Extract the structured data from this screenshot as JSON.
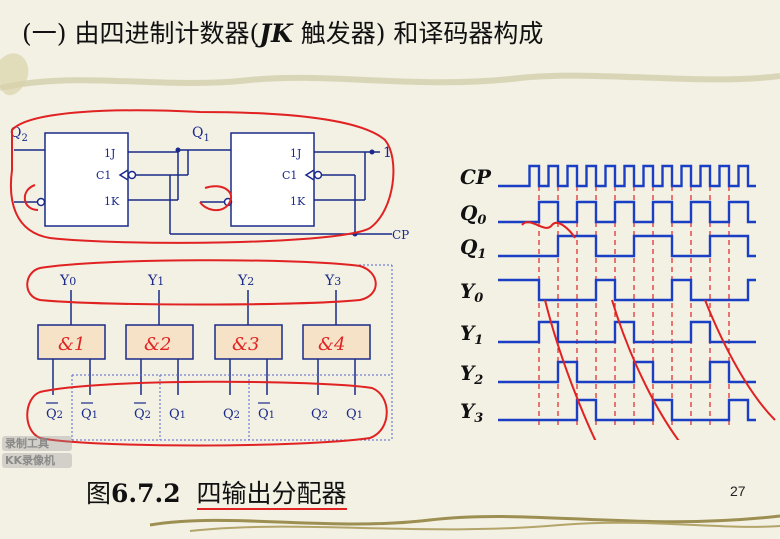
{
  "title": {
    "prefix": "(一) 由四进制计数器(",
    "jk": "JK",
    "suffix": " 触发器) 和译码器构成"
  },
  "circuit": {
    "ff1": {
      "pin_j": "1J",
      "pin_c": "C1",
      "pin_k": "1K"
    },
    "ff2": {
      "pin_j": "1J",
      "pin_c": "C1",
      "pin_k": "1K"
    },
    "q2_label": "Q",
    "q2_sub": "2",
    "q1_label": "Q",
    "q1_sub": "1",
    "one_label": "1",
    "cp_label": "CP",
    "outputs": [
      {
        "label": "Y",
        "sub": "0"
      },
      {
        "label": "Y",
        "sub": "1"
      },
      {
        "label": "Y",
        "sub": "2"
      },
      {
        "label": "Y",
        "sub": "3"
      }
    ],
    "gate_inputs": [
      [
        {
          "label": "Q",
          "sub": "2",
          "bar": true
        },
        {
          "label": "Q",
          "sub": "1",
          "bar": true
        }
      ],
      [
        {
          "label": "Q",
          "sub": "2",
          "bar": true
        },
        {
          "label": "Q",
          "sub": "1",
          "bar": false
        }
      ],
      [
        {
          "label": "Q",
          "sub": "2",
          "bar": false
        },
        {
          "label": "Q",
          "sub": "1",
          "bar": true
        }
      ],
      [
        {
          "label": "Q",
          "sub": "2",
          "bar": false
        },
        {
          "label": "Q",
          "sub": "1",
          "bar": false
        }
      ]
    ],
    "gate_marks": [
      "&1",
      "&2",
      "&3",
      "&4"
    ]
  },
  "waveforms": {
    "signals": [
      {
        "name": "CP",
        "sub": "",
        "pattern": [
          0,
          1,
          0,
          1,
          0,
          1,
          0,
          1,
          0,
          1,
          0,
          1,
          0,
          1,
          0,
          1,
          0,
          1,
          0,
          1,
          0,
          1,
          0,
          1,
          0
        ]
      },
      {
        "name": "Q",
        "sub": "0",
        "pattern": [
          0,
          0,
          1,
          1,
          0,
          0,
          1,
          1,
          0,
          0,
          1,
          1,
          0,
          0,
          1,
          1,
          0,
          0,
          1,
          1,
          0,
          0,
          1,
          1,
          0
        ]
      },
      {
        "name": "Q",
        "sub": "1",
        "pattern": [
          0,
          0,
          0,
          0,
          1,
          1,
          1,
          1,
          0,
          0,
          0,
          0,
          1,
          1,
          1,
          1,
          0,
          0,
          0,
          0,
          1,
          1,
          1,
          1,
          0
        ]
      },
      {
        "name": "Y",
        "sub": "0",
        "pattern": [
          1,
          1,
          0,
          0,
          0,
          0,
          0,
          0,
          1,
          1,
          0,
          0,
          0,
          0,
          0,
          0,
          1,
          1,
          0,
          0,
          0,
          0,
          0,
          0,
          1
        ]
      },
      {
        "name": "Y",
        "sub": "1",
        "pattern": [
          0,
          0,
          1,
          1,
          0,
          0,
          0,
          0,
          0,
          0,
          1,
          1,
          0,
          0,
          0,
          0,
          0,
          0,
          1,
          1,
          0,
          0,
          0,
          0,
          0
        ]
      },
      {
        "name": "Y",
        "sub": "2",
        "pattern": [
          0,
          0,
          0,
          0,
          1,
          1,
          0,
          0,
          0,
          0,
          0,
          0,
          1,
          1,
          0,
          0,
          0,
          0,
          0,
          0,
          1,
          1,
          0,
          0,
          0
        ]
      },
      {
        "name": "Y",
        "sub": "3",
        "pattern": [
          0,
          0,
          0,
          0,
          0,
          0,
          1,
          1,
          0,
          0,
          0,
          0,
          0,
          0,
          1,
          1,
          0,
          0,
          0,
          0,
          0,
          0,
          1,
          1,
          0
        ]
      }
    ]
  },
  "caption": {
    "prefix": "图",
    "number": "6.7.2",
    "text": "四输出分配器"
  },
  "page_number": "27",
  "watermark": {
    "line1": "录制工具",
    "line2": "KK录像机"
  },
  "colors": {
    "wave": "#1a3fc4",
    "annotation": "#e02222",
    "circuit": "#1a2a8a",
    "grid_dash": "#e02222"
  }
}
